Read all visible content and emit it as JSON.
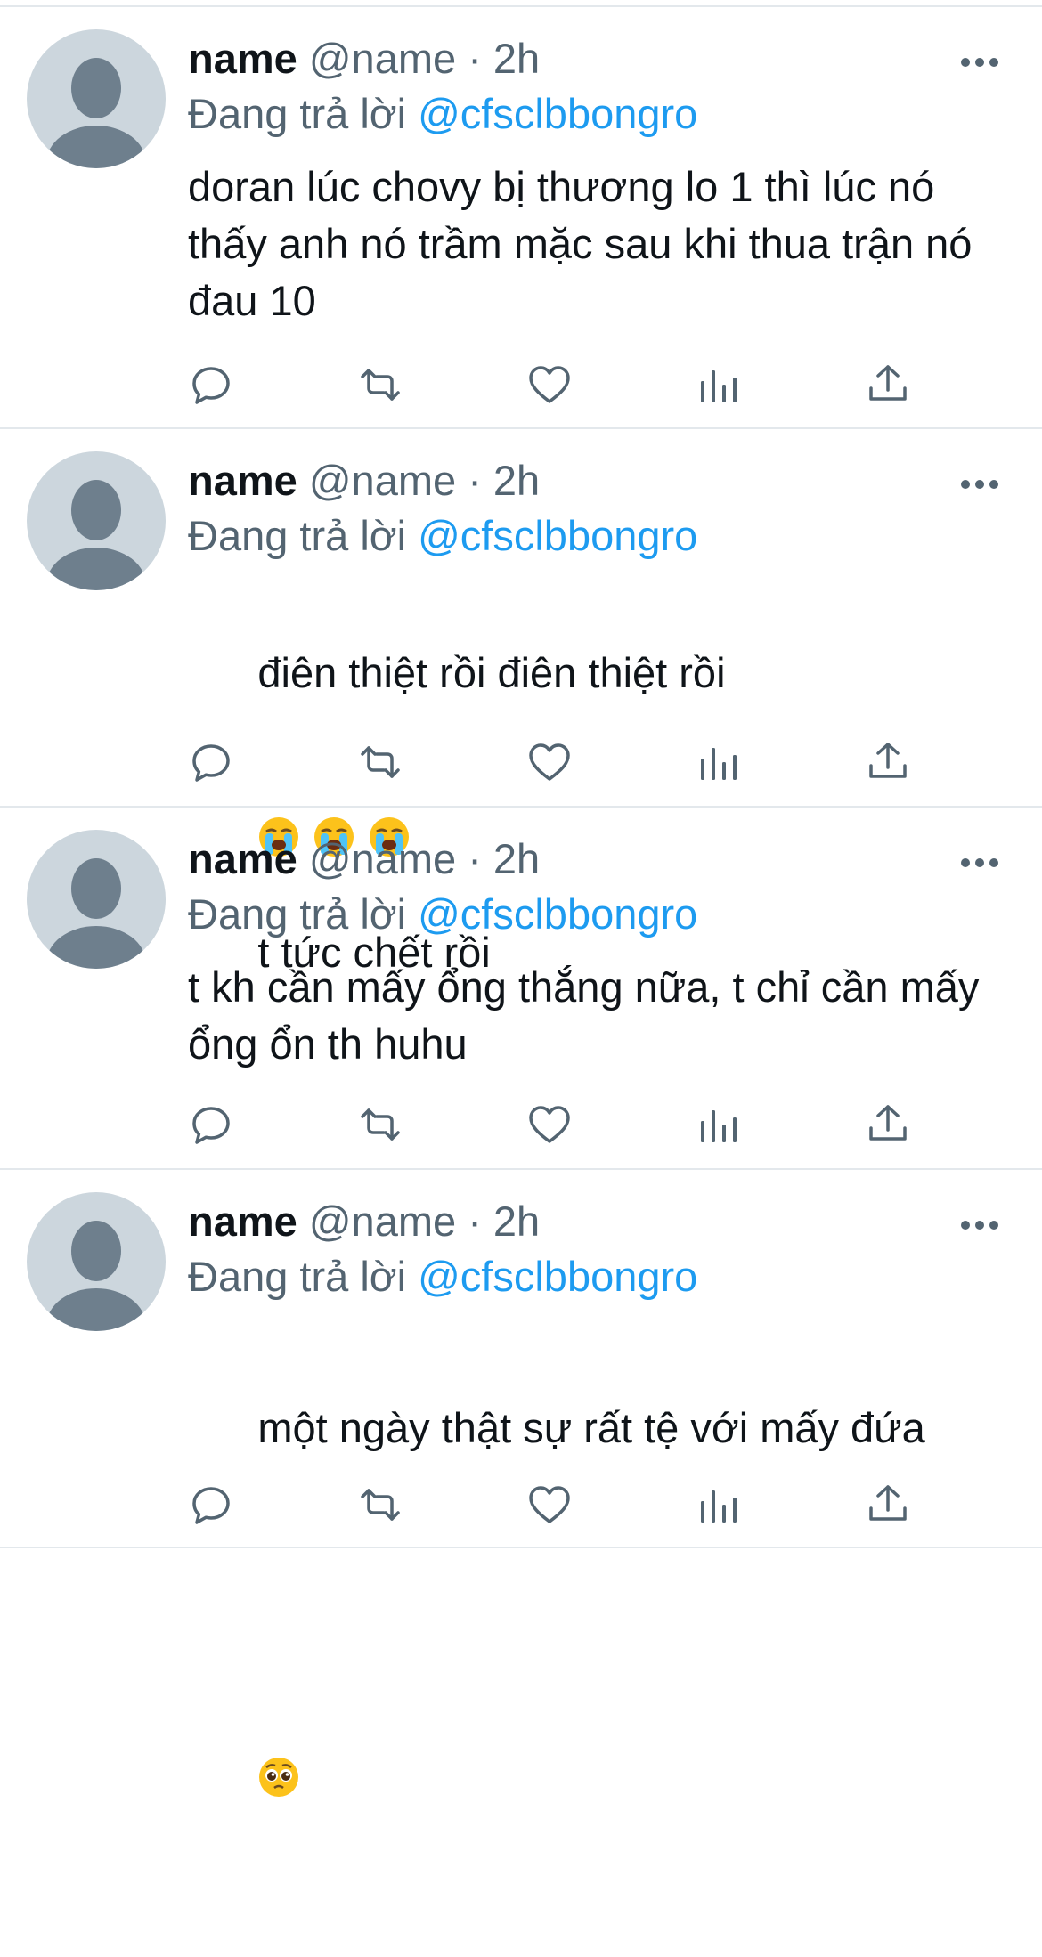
{
  "tweets": [
    {
      "name": "name",
      "handle": "@name",
      "separator": "·",
      "time": "2h",
      "replying_prefix": "Đang trả lời",
      "replying_to": "@cfsclbbongro",
      "text": "doran lúc chovy bị thương lo 1 thì lúc nó thấy anh nó trầm mặc sau khi thua trận nó đau 10",
      "emojis": [],
      "text_after_emojis": ""
    },
    {
      "name": "name",
      "handle": "@name",
      "separator": "·",
      "time": "2h",
      "replying_prefix": "Đang trả lời",
      "replying_to": "@cfsclbbongro",
      "text": "điên thiệt rồi điên thiệt rồi",
      "emojis": [
        "loudly-crying-face-emoji",
        "loudly-crying-face-emoji",
        "loudly-crying-face-emoji"
      ],
      "text_after_emojis": "t tức chết rồi"
    },
    {
      "name": "name",
      "handle": "@name",
      "separator": "·",
      "time": "2h",
      "replying_prefix": "Đang trả lời",
      "replying_to": "@cfsclbbongro",
      "text": "t kh cần mấy ổng thắng nữa, t chỉ cần mấy ổng ổn th huhu",
      "emojis": [],
      "text_after_emojis": ""
    },
    {
      "name": "name",
      "handle": "@name",
      "separator": "·",
      "time": "2h",
      "replying_prefix": "Đang trả lời",
      "replying_to": "@cfsclbbongro",
      "text": "một ngày thật sự rất tệ với mấy đứa",
      "emojis": [
        "pleading-face-emoji"
      ],
      "text_after_emojis": ""
    }
  ],
  "action_icons": [
    "reply-icon",
    "retweet-icon",
    "like-icon",
    "views-icon",
    "share-icon"
  ],
  "colors": {
    "text": "#0f1419",
    "secondary": "#536471",
    "mention": "#1d9bf0",
    "divider": "#e3e8ec",
    "avatar_bg": "#ccd6dd",
    "avatar_fg": "#6e7f8d"
  }
}
